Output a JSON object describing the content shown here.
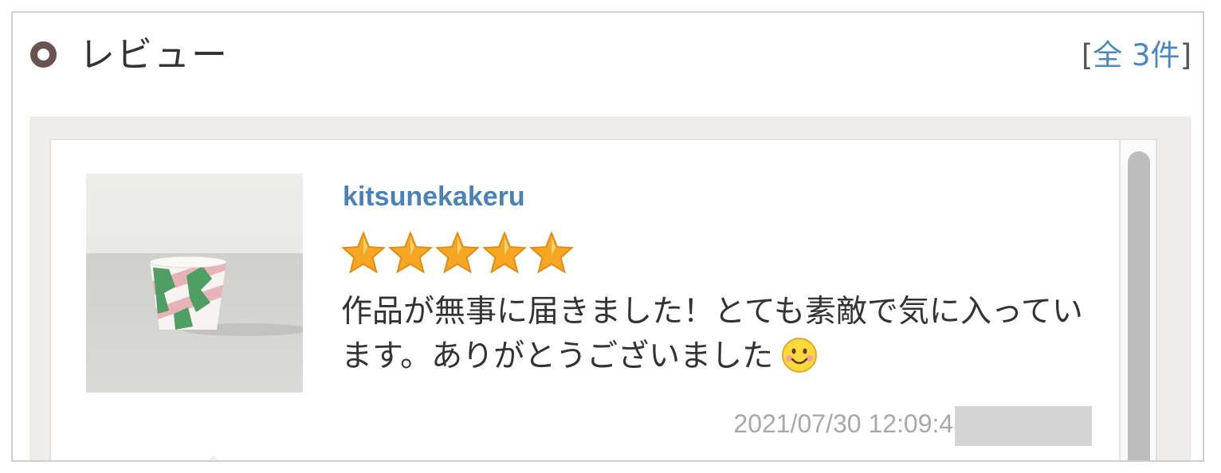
{
  "header": {
    "title": "レビュー",
    "count_open": "[",
    "count_link": "全 3件",
    "count_close": "]"
  },
  "reviews": [
    {
      "username": "kitsunekakeru",
      "rating": 5,
      "rating_max": 5,
      "text": "作品が無事に届きました！とても素敵で気に入っています。ありがとうございました",
      "emoji_icon": "smiley-face-icon",
      "date": "2021/07/30 12:09:48",
      "image_icon": "green-pink-cup-photo"
    }
  ],
  "colors": {
    "link": "#4a82b8",
    "star": "#f5a623",
    "ring": "#6a5450",
    "panel_bg": "#f0ecea"
  }
}
